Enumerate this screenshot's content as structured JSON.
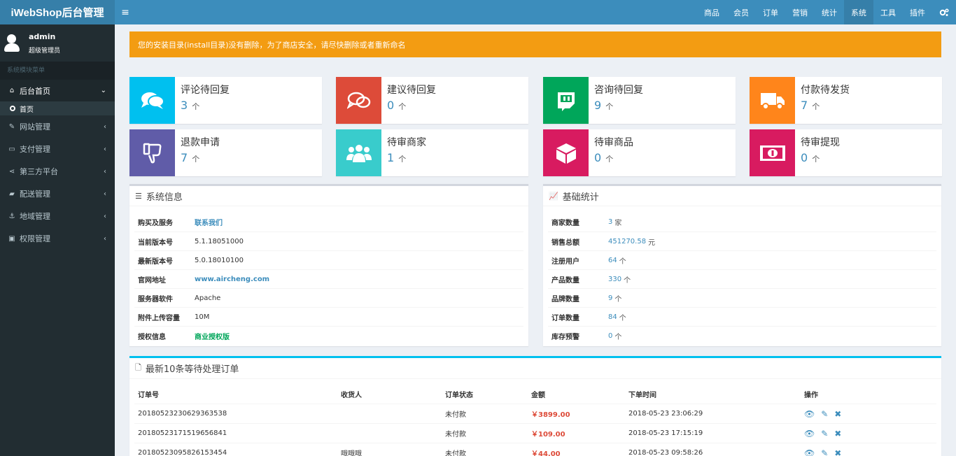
{
  "brand": "iWebShop后台管理",
  "toggle_icon": "≡",
  "topnav": [
    "商品",
    "会员",
    "订单",
    "营销",
    "统计",
    "系统",
    "工具",
    "插件"
  ],
  "topnav_active": "系统",
  "user": {
    "name": "admin",
    "role": "超级管理员"
  },
  "menu_header": "系统模块菜单",
  "menu": {
    "home": {
      "label": "后台首页",
      "icon": "home-icon"
    },
    "home_sub": "首页",
    "items": [
      {
        "label": "网站管理",
        "icon": "wrench-icon"
      },
      {
        "label": "支付管理",
        "icon": "credit-card-icon"
      },
      {
        "label": "第三方平台",
        "icon": "share-icon"
      },
      {
        "label": "配送管理",
        "icon": "truck-icon"
      },
      {
        "label": "地域管理",
        "icon": "anchor-icon"
      },
      {
        "label": "权限管理",
        "icon": "lock-icon"
      }
    ]
  },
  "alert": "您的安装目录(install目录)没有删除，为了商店安全，请尽快删除或者重新命名",
  "stats": [
    {
      "label": "评论待回复",
      "value": "3",
      "unit": "个",
      "color": "#00c0ef",
      "icon": "comments-icon"
    },
    {
      "label": "建议待回复",
      "value": "0",
      "unit": "个",
      "color": "#dd4b39",
      "icon": "chat-icon"
    },
    {
      "label": "咨询待回复",
      "value": "9",
      "unit": "个",
      "color": "#00a65a",
      "icon": "twitch-icon"
    },
    {
      "label": "付款待发货",
      "value": "7",
      "unit": "个",
      "color": "#ff851b",
      "icon": "truck-icon"
    },
    {
      "label": "退款申请",
      "value": "7",
      "unit": "个",
      "color": "#605ca8",
      "icon": "thumbs-down-icon"
    },
    {
      "label": "待审商家",
      "value": "1",
      "unit": "个",
      "color": "#39cccc",
      "icon": "users-icon"
    },
    {
      "label": "待审商品",
      "value": "0",
      "unit": "个",
      "color": "#d81b60",
      "icon": "cube-icon"
    },
    {
      "label": "待审提现",
      "value": "0",
      "unit": "个",
      "color": "#d81b60",
      "icon": "money-icon"
    }
  ],
  "sysinfo": {
    "title": "系统信息",
    "rows": [
      {
        "k": "购买及服务",
        "v": "联系我们"
      },
      {
        "k": "当前版本号",
        "v": "5.1.18051000"
      },
      {
        "k": "最新版本号",
        "v": "5.0.18010100"
      },
      {
        "k": "官网地址",
        "v": "www.aircheng.com"
      },
      {
        "k": "服务器软件",
        "v": "Apache"
      },
      {
        "k": "附件上传容量",
        "v": "10M"
      },
      {
        "k": "授权信息",
        "v": "商业授权版"
      }
    ]
  },
  "basestats": {
    "title": "基础统计",
    "rows": [
      {
        "k": "商家数量",
        "v": "3",
        "u": "家"
      },
      {
        "k": "销售总额",
        "v": "451270.58",
        "u": "元"
      },
      {
        "k": "注册用户",
        "v": "64",
        "u": "个"
      },
      {
        "k": "产品数量",
        "v": "330",
        "u": "个"
      },
      {
        "k": "品牌数量",
        "v": "9",
        "u": "个"
      },
      {
        "k": "订单数量",
        "v": "84",
        "u": "个"
      },
      {
        "k": "库存预警",
        "v": "0",
        "u": "个"
      }
    ]
  },
  "orders": {
    "title": "最新10条等待处理订单",
    "headers": [
      "订单号",
      "收货人",
      "订单状态",
      "金额",
      "下单时间",
      "操作"
    ],
    "rows": [
      {
        "no": "20180523230629363538",
        "name": "",
        "status": "未付款",
        "amount": "￥3899.00",
        "time": "2018-05-23 23:06:29"
      },
      {
        "no": "20180523171519656841",
        "name": "",
        "status": "未付款",
        "amount": "￥109.00",
        "time": "2018-05-23 17:15:19"
      },
      {
        "no": "20180523095826153454",
        "name": "哦哦哦",
        "status": "未付款",
        "amount": "￥44.00",
        "time": "2018-05-23 09:58:26"
      }
    ]
  }
}
